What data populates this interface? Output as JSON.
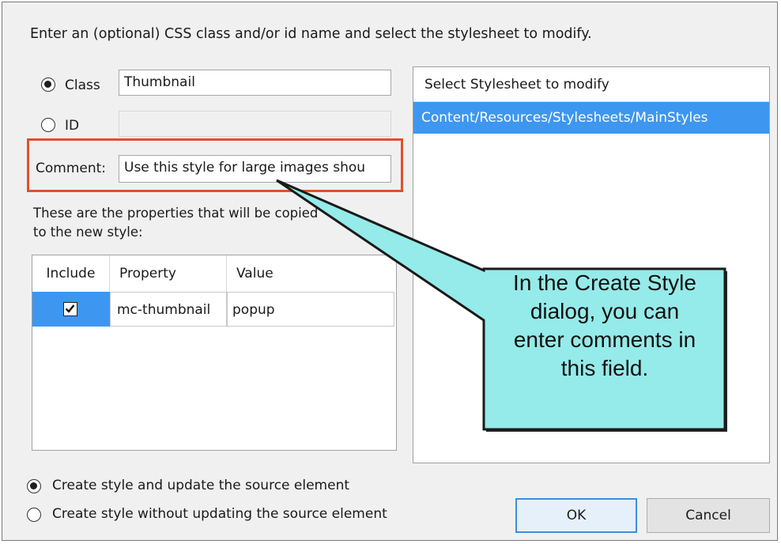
{
  "instruction": "Enter an (optional) CSS class and/or id name and select the stylesheet to modify.",
  "class_option": {
    "label": "Class",
    "value": "Thumbnail",
    "selected": true
  },
  "id_option": {
    "label": "ID",
    "value": "",
    "selected": false
  },
  "comment": {
    "label": "Comment:",
    "value": "Use this style for large images shou"
  },
  "properties_caption_line1": "These are the properties that will be copied",
  "properties_caption_line2": "to the new style:",
  "properties_table": {
    "columns": [
      "Include",
      "Property",
      "Value"
    ],
    "rows": [
      {
        "include": true,
        "property": "mc-thumbnail",
        "value": "popup"
      }
    ]
  },
  "stylesheet_list": {
    "header": "Select Stylesheet to modify",
    "items": [
      "Content/Resources/Stylesheets/MainStyles"
    ],
    "selected_index": 0
  },
  "update_options": [
    {
      "label": "Create style and update the source element",
      "selected": true
    },
    {
      "label": "Create style without updating the source element",
      "selected": false
    }
  ],
  "buttons": {
    "ok": "OK",
    "cancel": "Cancel"
  },
  "callout": {
    "lines": [
      "In the Create Style",
      "dialog, you can",
      "enter comments in",
      "this field."
    ]
  },
  "colors": {
    "callout_fill": "#95ebe9",
    "highlight_border": "#e0502d",
    "selection": "#3d97f0"
  }
}
